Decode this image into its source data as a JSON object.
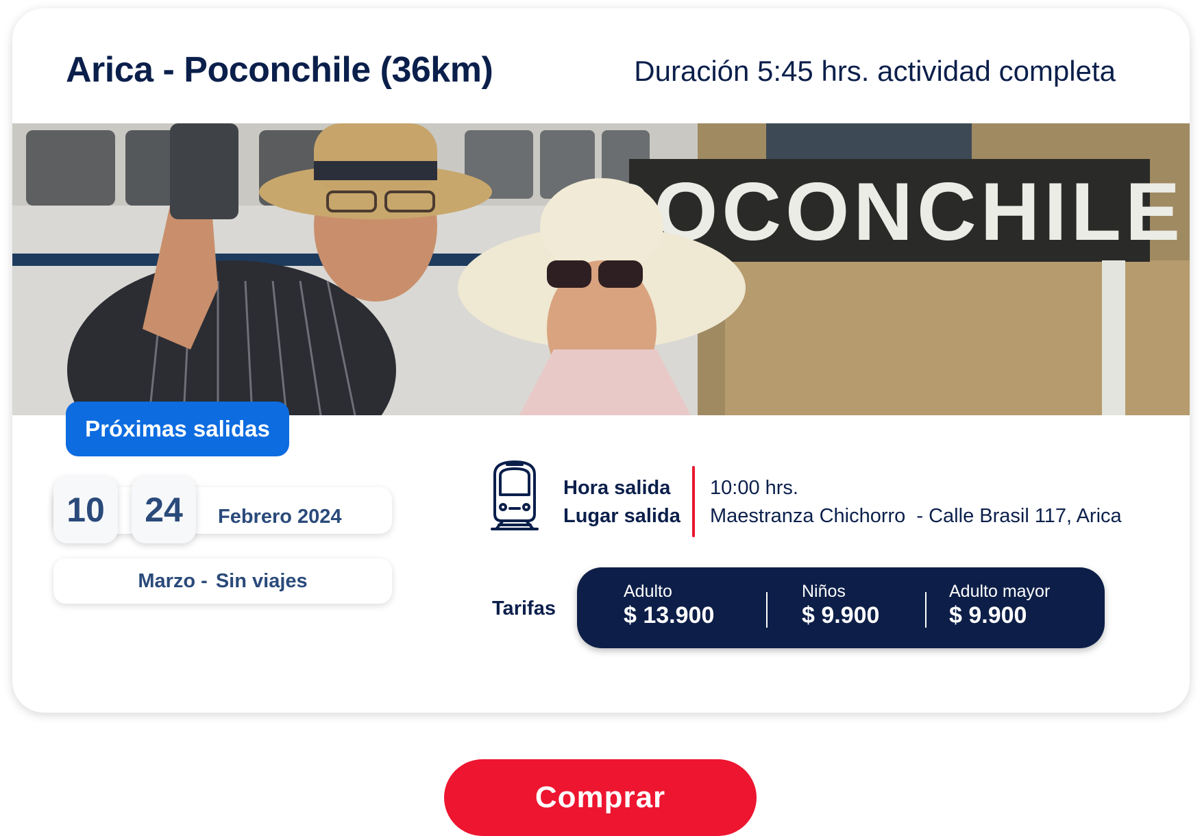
{
  "header": {
    "title": "Arica - Poconchile (36km)",
    "duration": "Duración 5:45 hrs. actividad completa"
  },
  "hero": {
    "sign_text": "POCONCHILE"
  },
  "departures": {
    "badge_label": "Próximas salidas",
    "days": [
      "10",
      "24"
    ],
    "month": "Febrero 2024",
    "next_month": "Marzo -",
    "next_month_status": "Sin viajes"
  },
  "trip_info": {
    "time_label": "Hora salida",
    "place_label": "Lugar salida",
    "time_value": "10:00 hrs.",
    "place_value": "Maestranza Chichorro  - Calle Brasil 117, Arica"
  },
  "fares": {
    "label": "Tarifas",
    "items": [
      {
        "label": "Adulto",
        "price": "$ 13.900"
      },
      {
        "label": "Niños",
        "price": "$ 9.900"
      },
      {
        "label": "Adulto mayor",
        "price": "$ 9.900"
      }
    ]
  },
  "actions": {
    "buy_label": "Comprar"
  },
  "colors": {
    "navy": "#0b1f4b",
    "blue_badge": "#0d6ce0",
    "fare_bg": "#0d1f48",
    "red": "#e8182e",
    "buy_button": "#ed1530"
  }
}
